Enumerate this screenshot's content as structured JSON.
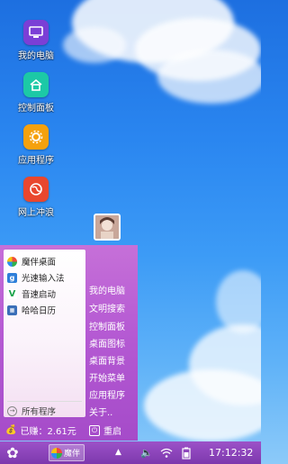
{
  "desktop": {
    "icons": [
      {
        "label": "我的电脑"
      },
      {
        "label": "控制面板"
      },
      {
        "label": "应用程序"
      },
      {
        "label": "网上冲浪"
      }
    ]
  },
  "start_menu": {
    "apps": [
      {
        "label": "魔伴桌面",
        "icon": "pinwheel-icon"
      },
      {
        "label": "光速输入法",
        "icon": "g-icon"
      },
      {
        "label": "音速启动",
        "icon": "v-icon"
      },
      {
        "label": "哈哈日历",
        "icon": "calendar-icon"
      }
    ],
    "all_programs": "所有程序",
    "right_items": [
      "我的电脑",
      "文明搜索",
      "控制面板",
      "桌面图标",
      "桌面背景",
      "开始菜单",
      "应用程序",
      "关于.."
    ],
    "earned": "已赚：2.61元",
    "restart": "重启"
  },
  "taskbar": {
    "task_label": "魔伴",
    "clock": "17:12:32"
  },
  "colors": {
    "menu": "#b55ad3",
    "taskbar": "#8a44b8",
    "sky": "#2a86f0"
  }
}
